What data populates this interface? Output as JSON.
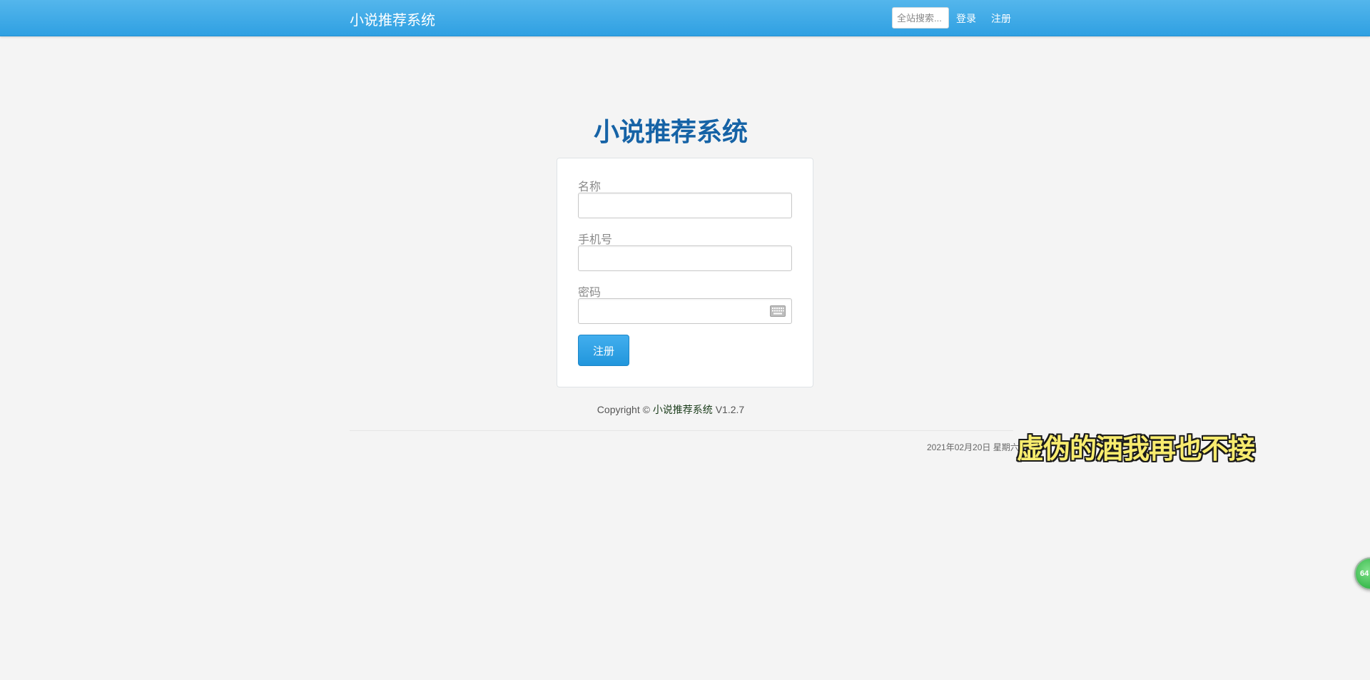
{
  "navbar": {
    "brand": "小说推荐系统",
    "search_placeholder": "全站搜索...",
    "login_label": "登录",
    "register_label": "注册"
  },
  "main": {
    "title": "小说推荐系统",
    "form": {
      "name_label": "名称",
      "name_value": "",
      "phone_label": "手机号",
      "phone_value": "",
      "password_label": "密码",
      "password_value": "",
      "submit_label": "注册"
    }
  },
  "footer": {
    "copyright_prefix": "Copyright ©",
    "copyright_link": "小说推荐系统",
    "version": "V1.2.7",
    "date_text": "2021年02月20日 星期六"
  },
  "overlay": {
    "lyric": "虚伪的酒我再也不接",
    "badge_text": "64"
  },
  "colors": {
    "navbar": "#2fa0e2",
    "title": "#1663a6",
    "button": "#2196dc",
    "background": "#f4f4f4",
    "lyric": "#f8ec6e",
    "badge": "#36b84a"
  },
  "icons": {
    "password_field": "keyboard-icon"
  }
}
